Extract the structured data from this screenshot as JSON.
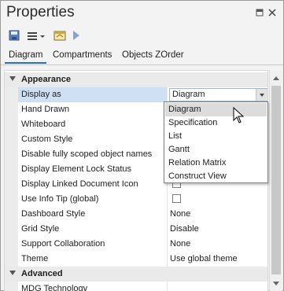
{
  "window": {
    "title": "Properties"
  },
  "toolbar": {
    "save_icon": "save-icon",
    "menu_icon": "menu-icon",
    "options_icon": "element-options-icon",
    "run_icon": "play-icon"
  },
  "tabs": [
    {
      "label": "Diagram",
      "active": true
    },
    {
      "label": "Compartments",
      "active": false
    },
    {
      "label": "Objects ZOrder",
      "active": false
    }
  ],
  "categories": {
    "appearance": "Appearance",
    "advanced": "Advanced"
  },
  "properties": [
    {
      "name": "Display as",
      "value": "Diagram",
      "kind": "combo"
    },
    {
      "name": "Hand Drawn",
      "value": "",
      "kind": "checkbox"
    },
    {
      "name": "Whiteboard",
      "value": "",
      "kind": "checkbox"
    },
    {
      "name": "Custom Style",
      "value": "",
      "kind": "checkbox"
    },
    {
      "name": "Disable fully scoped object names",
      "value": "",
      "kind": "checkbox"
    },
    {
      "name": "Display Element Lock Status",
      "value": "",
      "kind": "checkbox"
    },
    {
      "name": "Display Linked Document Icon",
      "value": "",
      "kind": "checkbox"
    },
    {
      "name": "Use Info Tip (global)",
      "value": "",
      "kind": "checkbox"
    },
    {
      "name": "Dashboard Style",
      "value": "None",
      "kind": "text"
    },
    {
      "name": "Grid Style",
      "value": "Disable",
      "kind": "text"
    },
    {
      "name": "Support Collaboration",
      "value": "None",
      "kind": "text"
    },
    {
      "name": "Theme",
      "value": "Use global theme",
      "kind": "text"
    }
  ],
  "advanced_first": "MDG Technology",
  "dropdown_options": [
    "Diagram",
    "Specification",
    "List",
    "Gantt",
    "Relation Matrix",
    "Construct View"
  ],
  "dropdown_highlighted": "Diagram",
  "colors": {
    "accent": "#2a6cd0",
    "selection": "#cfe0f5"
  }
}
